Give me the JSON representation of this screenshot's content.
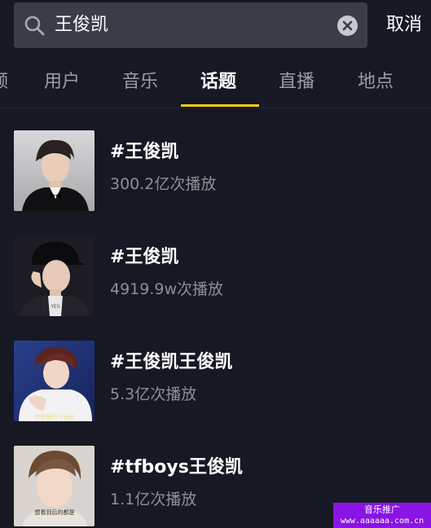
{
  "search": {
    "query": "王俊凯",
    "icon": "search-icon",
    "clear_icon": "clear-icon",
    "cancel_label": "取消"
  },
  "tabs": [
    {
      "label": "频",
      "active": false
    },
    {
      "label": "用户",
      "active": false
    },
    {
      "label": "音乐",
      "active": false
    },
    {
      "label": "话题",
      "active": true
    },
    {
      "label": "直播",
      "active": false
    },
    {
      "label": "地点",
      "active": false
    }
  ],
  "results": [
    {
      "title": "#王俊凯",
      "plays": "300.2亿次播放",
      "thumb_caption": ""
    },
    {
      "title": "#王俊凯",
      "plays": "4919.9w次播放",
      "thumb_caption": "YES"
    },
    {
      "title": "#王俊凯王俊凯",
      "plays": "5.3亿次播放",
      "thumb_caption": "你转圈的下画呢"
    },
    {
      "title": "#tfboys王俊凯",
      "plays": "1.1亿次播放",
      "thumb_caption": "想看到后的都是"
    }
  ],
  "watermark": {
    "line1": "音乐推广",
    "line2": "www.aaaaaa.com.cn"
  },
  "colors": {
    "background": "#161823",
    "search_bg": "#3a3c47",
    "tab_active_underline": "#face15",
    "tab_inactive": "#9c9da3",
    "subtext": "#8e8f96",
    "watermark_bg": "#8a13e6"
  }
}
